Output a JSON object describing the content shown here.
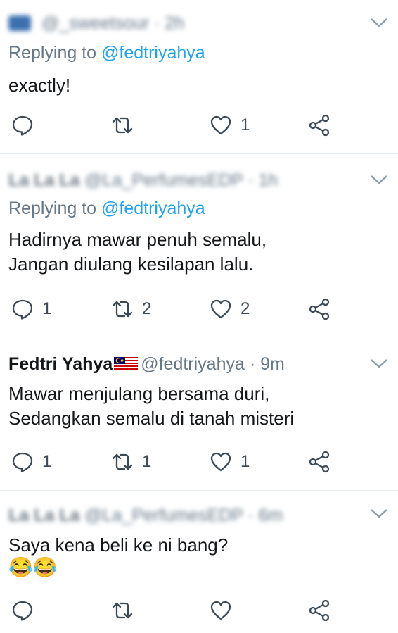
{
  "tweets": [
    {
      "author_name": "",
      "handle_line": "@_sweetsour · 2h",
      "replying_prefix": "Replying to",
      "replying_handle": "@fedtriyahya",
      "text_lines": [
        "exactly!"
      ],
      "emoji": "",
      "replies": "",
      "retweets": "",
      "likes": "1"
    },
    {
      "author_name": "La La La",
      "handle_line": "@La_PerfumesEDP · 1h",
      "replying_prefix": "Replying to",
      "replying_handle": "@fedtriyahya",
      "text_lines": [
        "Hadirnya mawar penuh semalu,",
        "Jangan diulang kesilapan lalu."
      ],
      "emoji": "",
      "replies": "1",
      "retweets": "2",
      "likes": "2"
    },
    {
      "author_name": "Fedtri Yahya",
      "handle_line": "@fedtriyahya · 9m",
      "replying_prefix": "",
      "replying_handle": "",
      "text_lines": [
        "Mawar menjulang bersama duri,",
        "Sedangkan semalu di tanah misteri"
      ],
      "emoji": "",
      "replies": "1",
      "retweets": "1",
      "likes": "1"
    },
    {
      "author_name": "La La La",
      "handle_line": "@La_PerfumesEDP · 6m",
      "replying_prefix": "",
      "replying_handle": "",
      "text_lines": [
        "Saya kena beli ke ni bang?"
      ],
      "emoji": "😂😂",
      "replies": "",
      "retweets": "",
      "likes": ""
    }
  ],
  "icons": {
    "reply": "reply-icon",
    "retweet": "retweet-icon",
    "like": "heart-icon",
    "share": "share-icon",
    "more": "chevron-down-icon"
  },
  "colors": {
    "link": "#1da1f2",
    "secondary_text": "#657786",
    "icon": "#3d4a55",
    "divider": "#e6ecf0"
  }
}
